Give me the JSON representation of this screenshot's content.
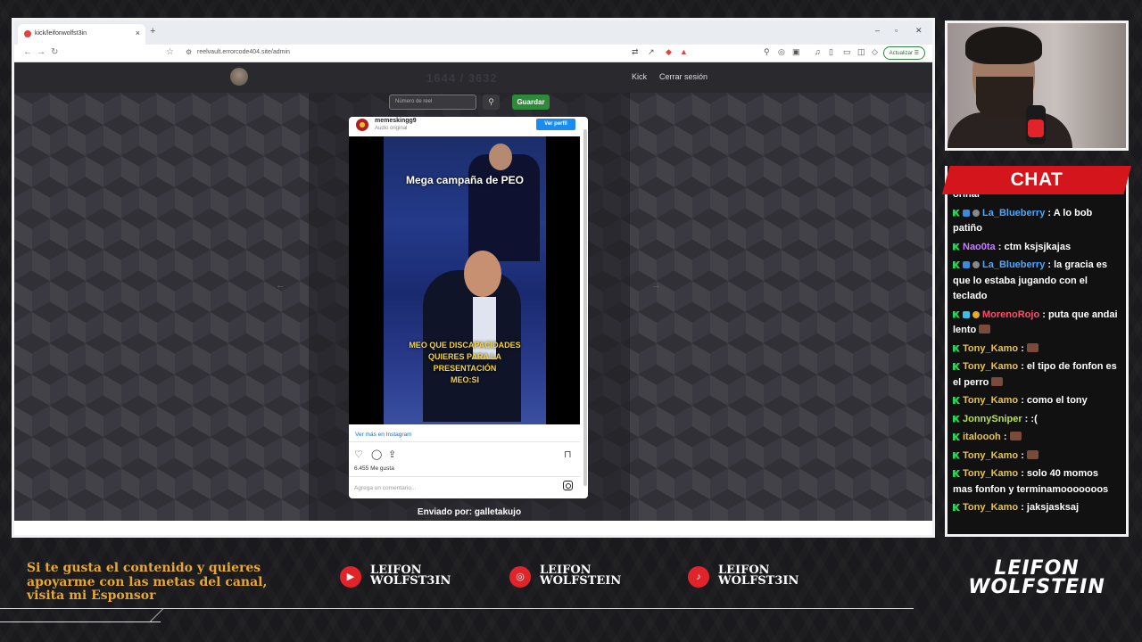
{
  "browser": {
    "tab_title": "kick/leifonwolfst3in",
    "tab_close": "×",
    "new_tab": "+",
    "url": "reelvault.errorcode404.site/admin",
    "update_label": "Actualizar",
    "win_min": "–",
    "win_max": "▫",
    "win_close": "✕"
  },
  "site": {
    "title": "1644 / 3632",
    "nav_kick": "Kick",
    "nav_logout": "Cerrar sesión",
    "reel_placeholder": "Número de reel",
    "search_icon": "search-icon",
    "save_label": "Guardar",
    "prev_arrow": "←",
    "next_arrow": "→",
    "sent_by": "Enviado por: galletakujo"
  },
  "instagram": {
    "username": "memeskingg9",
    "audio": "Audio original",
    "view_profile": "Ver perfil",
    "video_top_text": "Mega campaña de PEO",
    "video_bottom_text": "MEO QUE DISCAPACIDADES\nQUIERES PARA LA\nPRESENTACIÓN\nMEO:SI",
    "see_more": "Ver más en Instagram",
    "likes": "6.455 Me gusta",
    "comment_placeholder": "Agrega un comentario...",
    "icons": [
      "heart-icon",
      "comment-icon",
      "share-icon",
      "bookmark-icon",
      "instagram-icon"
    ]
  },
  "chat": {
    "title": "CHAT",
    "messages": [
      {
        "user": "",
        "text": "orinar",
        "color": "#ffffff"
      },
      {
        "user": "La_Blueberry",
        "text": "A lo bob patiño",
        "color": "#4aa8ff"
      },
      {
        "user": "Nao0ta",
        "text": "ctm ksjsjkajas",
        "color": "#c77dff"
      },
      {
        "user": "La_Blueberry",
        "text": "la gracia es que lo estaba jugando con el teclado",
        "color": "#4aa8ff"
      },
      {
        "user": "MorenoRojo",
        "text": "puta que andai lento",
        "color": "#ff4d6d"
      },
      {
        "user": "Tony_Kamo",
        "text": "",
        "color": "#e6c34a"
      },
      {
        "user": "Tony_Kamo",
        "text": "el tipo de fonfon es el perro",
        "color": "#e6c34a"
      },
      {
        "user": "Tony_Kamo",
        "text": "como el tony",
        "color": "#e6c34a"
      },
      {
        "user": "JonnySniper",
        "text": ":(",
        "color": "#b8e04a"
      },
      {
        "user": "italoooh",
        "text": "",
        "color": "#e6c34a"
      },
      {
        "user": "Tony_Kamo",
        "text": "",
        "color": "#e6c34a"
      },
      {
        "user": "Tony_Kamo",
        "text": "solo 40 momos mas fonfon y terminamooooooos",
        "color": "#e6c34a"
      },
      {
        "user": "Tony_Kamo",
        "text": "jaksjasksaj",
        "color": "#e6c34a"
      }
    ]
  },
  "footer": {
    "sponsor_text": "Si te gusta el contenido y quieres apoyarme con las metas del canal, visita mi Esponsor",
    "youtube": "LEIFON\nWOLFST3IN",
    "instagram": "LEIFON\nWOLFSTEIN",
    "tiktok": "LEIFON\nWOLFST3IN",
    "logo_line1": "LEIFON",
    "logo_line2": "WOLFSTEIN"
  }
}
